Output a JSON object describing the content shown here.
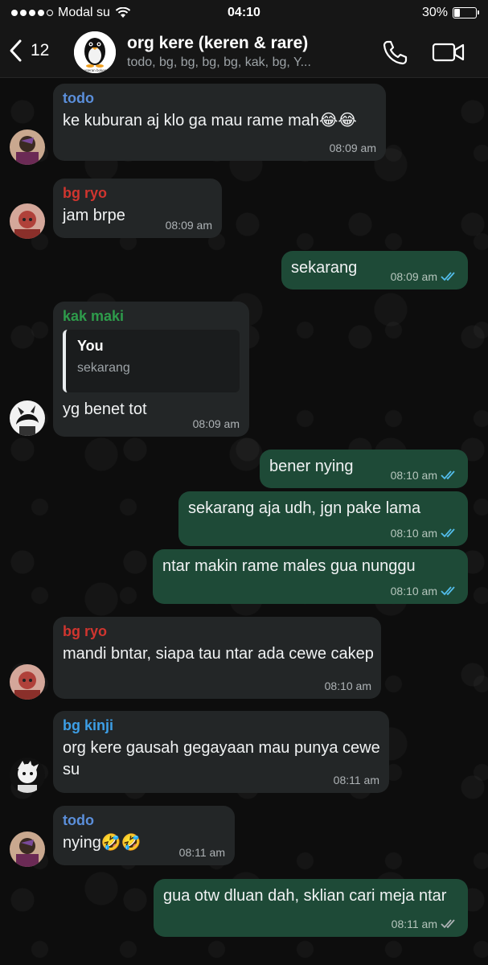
{
  "status_bar": {
    "carrier": "Modal su",
    "time": "04:10",
    "battery": "30%",
    "battery_level": 0.3
  },
  "header": {
    "back_count": "12",
    "title": "org kere (keren & rare)",
    "subtitle": "todo, bg, bg, bg, bg, kak, bg, Y...",
    "avatar_caption": "veteran bokep"
  },
  "colors": {
    "incoming_bubble": "#232627",
    "outgoing_bubble": "#1e4a37",
    "sender_todo": "#5b8fdb",
    "sender_ryo": "#d0352f",
    "sender_maki": "#2e9c4b",
    "sender_kinji": "#3d9fe6",
    "read_ticks": "#53bdeb"
  },
  "messages": [
    {
      "sender": "todo",
      "text": "ke kuburan aj klo ga mau rame mah😂😂",
      "time": "08:09 am"
    },
    {
      "sender": "bg ryo",
      "text": "jam brpe",
      "time": "08:09 am"
    },
    {
      "text": "sekarang",
      "time": "08:09 am"
    },
    {
      "sender": "kak maki",
      "quote_name": "You",
      "quote_text": "sekarang",
      "text": "yg benet tot",
      "time": "08:09 am"
    },
    {
      "text": "bener nying",
      "time": "08:10 am"
    },
    {
      "text": "sekarang aja udh, jgn pake lama",
      "time": "08:10 am"
    },
    {
      "text": "ntar makin rame males gua nunggu",
      "time": "08:10 am"
    },
    {
      "sender": "bg ryo",
      "text": "mandi bntar, siapa tau ntar ada cewe cakep",
      "time": "08:10 am"
    },
    {
      "sender": "bg kinji",
      "text": "org kere gausah gegayaan mau punya cewe su",
      "time": "08:11 am"
    },
    {
      "sender": "todo",
      "text": "nying🤣🤣",
      "time": "08:11 am"
    },
    {
      "text": "gua otw dluan dah, sklian cari meja ntar",
      "time": "08:11 am"
    }
  ]
}
